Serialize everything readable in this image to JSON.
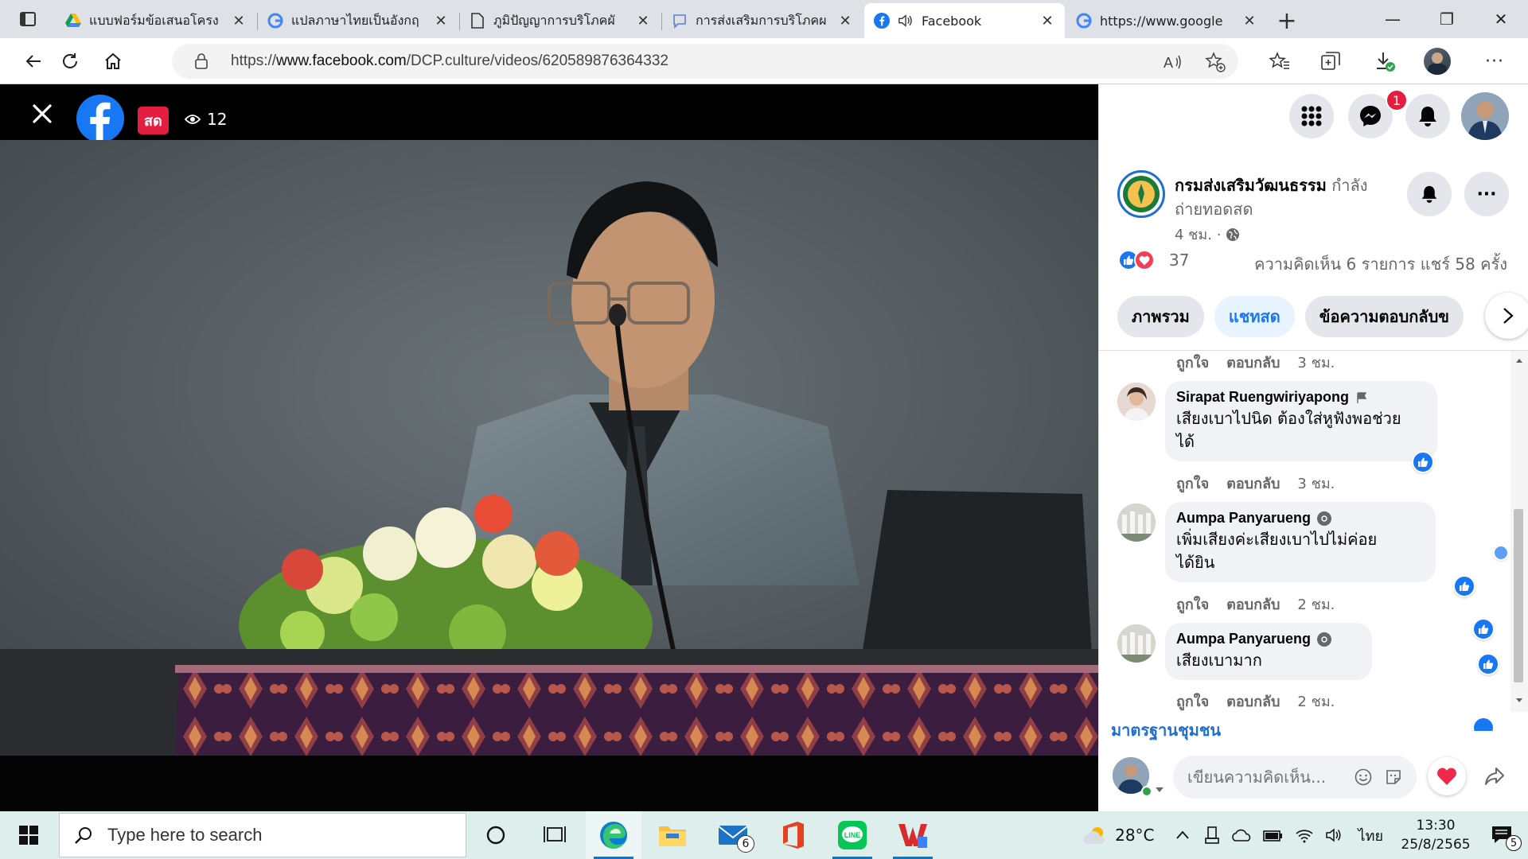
{
  "browser": {
    "tabs": [
      {
        "title": "แบบฟอร์มข้อเสนอโครง",
        "icon": "google-drive-icon"
      },
      {
        "title": "แปลภาษาไทยเป็นอังกฤ",
        "icon": "google-icon"
      },
      {
        "title": "ภูมิปัญญาการบริโภคผั",
        "icon": "document-icon"
      },
      {
        "title": "การส่งเสริมการบริโภคผ",
        "icon": "chat-icon"
      },
      {
        "title": "Facebook",
        "icon": "facebook-icon",
        "active": true,
        "audio": true
      },
      {
        "title": "https://www.google",
        "icon": "google-icon"
      }
    ],
    "url_prefix": "https://",
    "url_host": "www.facebook.com",
    "url_path": "/DCP.culture/videos/620589876364332",
    "download_badge": "✓"
  },
  "video": {
    "live_label": "สด",
    "viewer_count": "12"
  },
  "topbar": {
    "messenger_count": "1"
  },
  "post": {
    "page_name": "กรมส่งเสริมวัฒนธรรม",
    "status_text": "กำลังถ่ายทอดสด",
    "time": "4 ชม. ·",
    "reaction_count": "37",
    "stats": "ความคิดเห็น 6 รายการ  แชร์ 58 ครั้ง"
  },
  "tabs": [
    {
      "label": "ภาพรวม"
    },
    {
      "label": "แชทสด",
      "active": true
    },
    {
      "label": "ข้อความตอบกลับข"
    }
  ],
  "comment_actions": {
    "like": "ถูกใจ",
    "reply": "ตอบกลับ"
  },
  "comments": [
    {
      "time": "3 ชม."
    },
    {
      "name": "Sirapat Ruengwiriyapong",
      "text_line1": "เสียงเบาไปนิด ต้องใส่หูฟังพอช่วย",
      "text_line2": "ได้",
      "time": "3 ชม."
    },
    {
      "name": "Aumpa Panyarueng",
      "text_line1": "เพิ่มเสียงค่ะเสียงเบาไปไม่ค่อย",
      "text_line2": "ได้ยิน",
      "time": "2 ชม."
    },
    {
      "name": "Aumpa Panyarueng",
      "text_line1": "เสียงเบามาก",
      "time": "2 ชม."
    }
  ],
  "community_label": "มาตรฐานชุมชน",
  "composer": {
    "placeholder": "เขียนความคิดเห็น..."
  },
  "taskbar": {
    "search_placeholder": "Type here to search",
    "mail_badge": "6",
    "temperature": "28°C",
    "language": "ไทย",
    "time": "13:30",
    "date": "25/8/2565",
    "notification_count": "5"
  }
}
